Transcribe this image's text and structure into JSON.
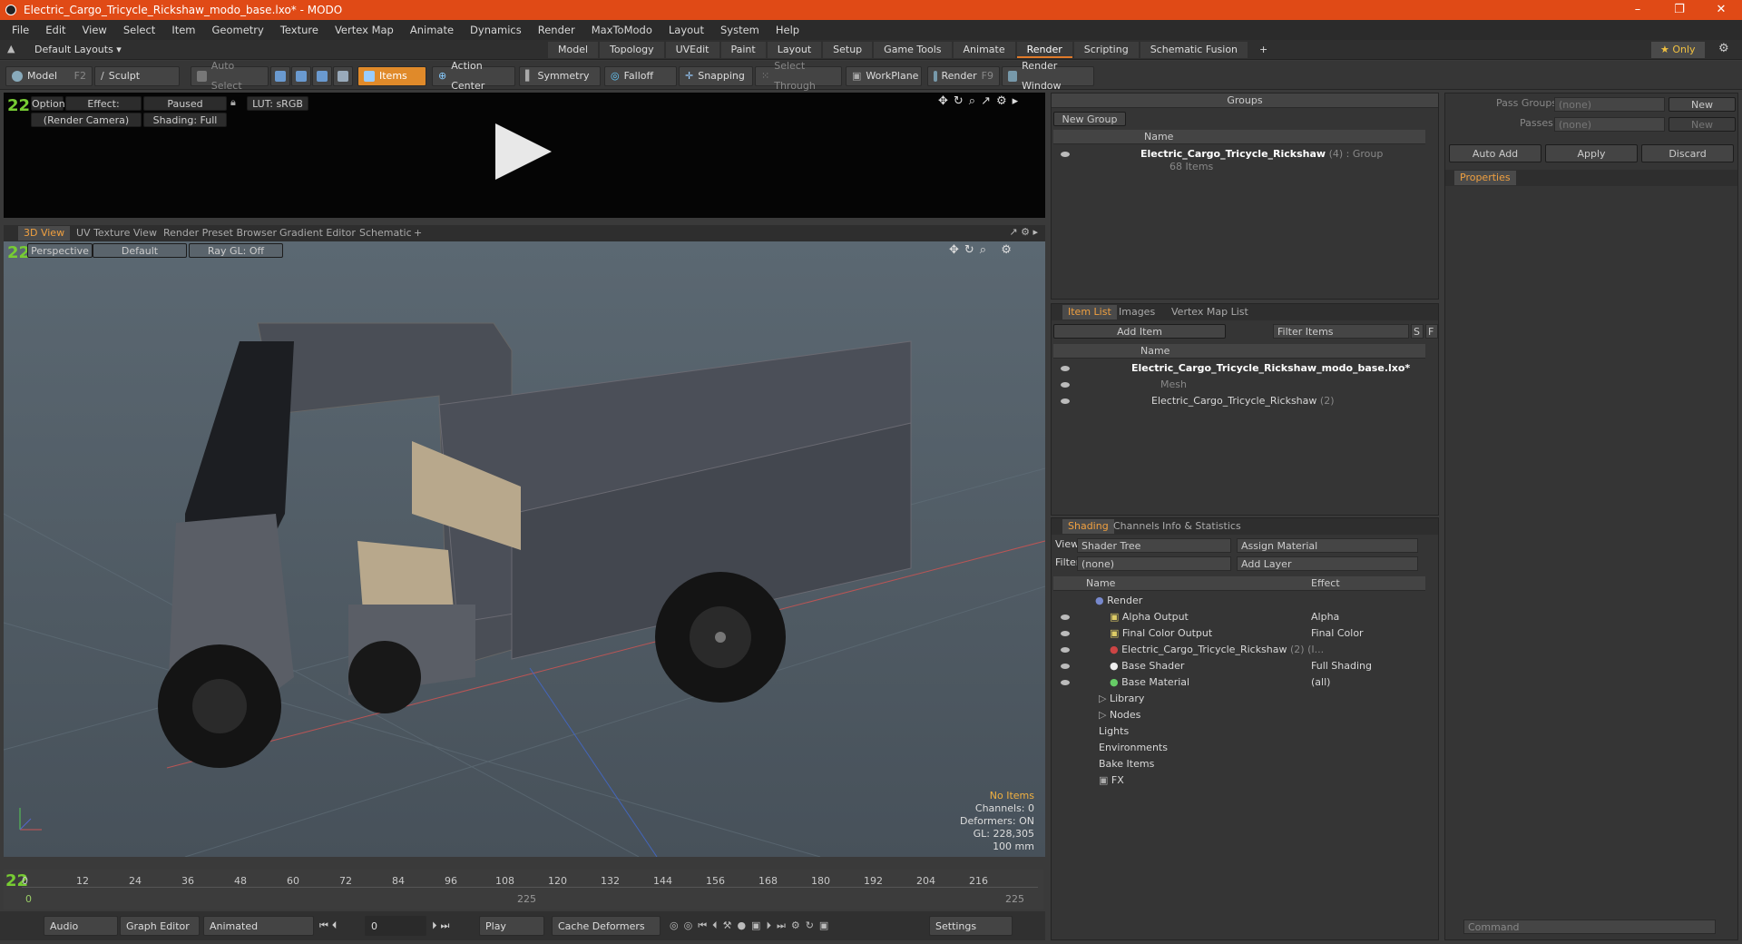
{
  "window": {
    "title": "Electric_Cargo_Tricycle_Rickshaw_modo_base.lxo* - MODO",
    "minimize": "–",
    "maximize": "❐",
    "close": "✕"
  },
  "menu": [
    "File",
    "Edit",
    "View",
    "Select",
    "Item",
    "Geometry",
    "Texture",
    "Vertex Map",
    "Animate",
    "Dynamics",
    "Render",
    "MaxToModo",
    "Layout",
    "System",
    "Help"
  ],
  "layouts": {
    "label": "Default Layouts ▾",
    "tabs": [
      "Model",
      "Topology",
      "UVEdit",
      "Paint",
      "Layout",
      "Setup",
      "Game Tools",
      "Animate",
      "Render",
      "Scripting",
      "Schematic Fusion"
    ],
    "active": "Render",
    "only": "★ Only"
  },
  "toolbar": {
    "model": "Model",
    "model_key": "F2",
    "sculpt": "Sculpt",
    "auto_select": "Auto Select",
    "items": "Items",
    "action_center": "Action Center",
    "symmetry": "Symmetry",
    "falloff": "Falloff",
    "snapping": "Snapping",
    "select_through": "Select Through",
    "workplane": "WorkPlane",
    "render": "Render",
    "render_key": "F9",
    "render_window": "Render Window"
  },
  "preview": {
    "options": "Options",
    "effect": "Effect: (Shadi...",
    "paused": "Paused",
    "lut": "LUT: sRGB",
    "camera": "(Render Camera)",
    "shading": "Shading: Full"
  },
  "viewport": {
    "tabs": [
      "3D View",
      "UV Texture View",
      "Render Preset Browser",
      "Gradient Editor",
      "Schematic"
    ],
    "perspective": "Perspective",
    "default": "Default",
    "raygl": "Ray GL: Off",
    "stats": {
      "items": "No Items",
      "channels": "Channels: 0",
      "deformers": "Deformers: ON",
      "gl": "GL: 228,305",
      "scale": "100 mm"
    }
  },
  "timeline": {
    "ticks": [
      "0",
      "12",
      "24",
      "36",
      "48",
      "60",
      "72",
      "84",
      "96",
      "108",
      "120",
      "132",
      "144",
      "156",
      "168",
      "180",
      "192",
      "204",
      "216"
    ],
    "end": "225",
    "end2": "225"
  },
  "bottom": {
    "audio": "Audio",
    "graph": "Graph Editor",
    "animated": "Animated",
    "frame": "0",
    "play": "Play",
    "cache": "Cache Deformers",
    "settings": "Settings",
    "command": "Command"
  },
  "groups": {
    "title": "Groups",
    "new_group": "New Group",
    "name_col": "Name",
    "row_name": "Electric_Cargo_Tricycle_Rickshaw",
    "row_count": "(4)",
    "row_type": ": Group",
    "row_items": "68 Items"
  },
  "itemlist": {
    "tabs": [
      "Item List",
      "Images",
      "Vertex Map List"
    ],
    "add_item": "Add Item",
    "filter": "Filter Items",
    "name_col": "Name",
    "rows": [
      "Electric_Cargo_Tricycle_Rickshaw_modo_base.lxo*",
      "Mesh",
      "Electric_Cargo_Tricycle_Rickshaw"
    ],
    "row3_count": "(2)",
    "f": "F",
    "s": "S"
  },
  "shading": {
    "tabs": [
      "Shading",
      "Channels",
      "Info & Statistics"
    ],
    "view_label": "View",
    "view_value": "Shader Tree",
    "assign": "Assign Material",
    "filter_label": "Filter",
    "filter_value": "(none)",
    "add_layer": "Add Layer",
    "name_col": "Name",
    "effect_col": "Effect",
    "rows": [
      {
        "name": "Render",
        "effect": ""
      },
      {
        "name": "Alpha Output",
        "effect": "Alpha"
      },
      {
        "name": "Final Color Output",
        "effect": "Final Color"
      },
      {
        "name": "Electric_Cargo_Tricycle_Rickshaw",
        "effect": ""
      },
      {
        "name": "Base Shader",
        "effect": "Full Shading"
      },
      {
        "name": "Base Material",
        "effect": "(all)"
      },
      {
        "name": "Library",
        "effect": ""
      },
      {
        "name": "Nodes",
        "effect": ""
      },
      {
        "name": "Lights",
        "effect": ""
      },
      {
        "name": "Environments",
        "effect": ""
      },
      {
        "name": "Bake Items",
        "effect": ""
      },
      {
        "name": "FX",
        "effect": ""
      }
    ],
    "row4_suffix": "(2) (I..."
  },
  "passes": {
    "pass_groups": "Pass Groups",
    "passes": "Passes",
    "none": "(none)",
    "new": "New",
    "auto_add": "Auto Add",
    "apply": "Apply",
    "discard": "Discard",
    "properties": "Properties"
  }
}
